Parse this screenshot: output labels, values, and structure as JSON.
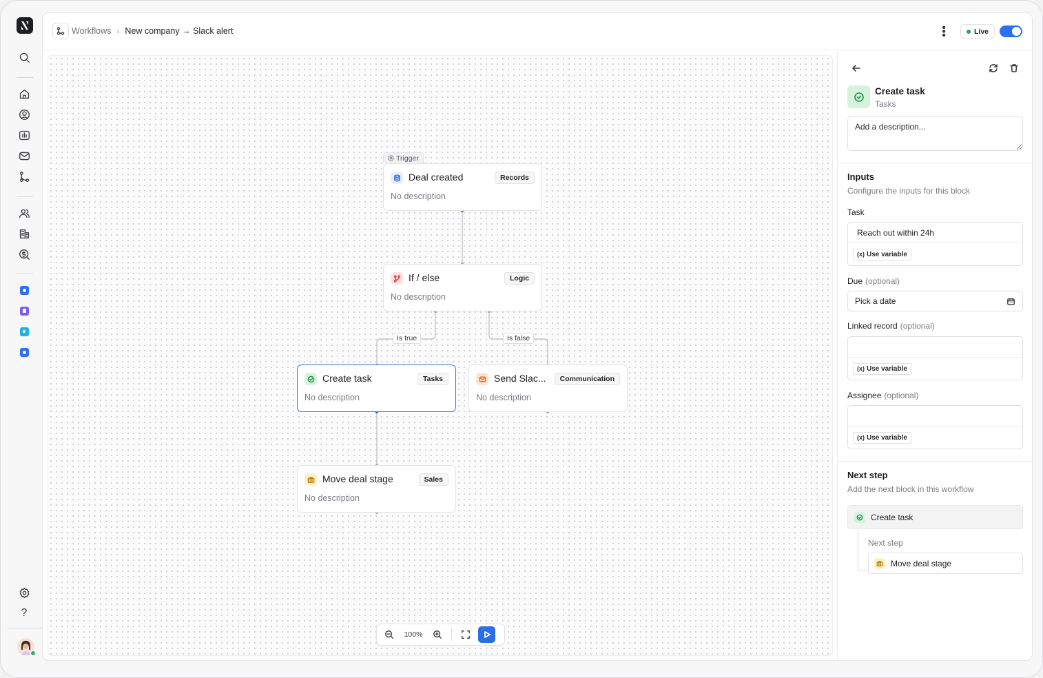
{
  "sidebar": {
    "top_icons": [
      "search-icon"
    ],
    "nav_icons": [
      "home-icon",
      "user-circle-icon",
      "analytics-icon",
      "inbox-icon",
      "workflow-icon"
    ],
    "section_icons": [
      "people-icon",
      "building-icon",
      "dollar-search-icon"
    ],
    "app_icons": [
      {
        "name": "app-blue-icon",
        "color": "#2f6fed"
      },
      {
        "name": "app-purple-icon",
        "color": "#7b5cf0"
      },
      {
        "name": "app-cyan-icon",
        "color": "#1fb1e0"
      },
      {
        "name": "app-blue2-icon",
        "color": "#2f6fed"
      }
    ],
    "bottom_icons": [
      "settings-icon",
      "help-icon"
    ]
  },
  "header": {
    "breadcrumb_root": "Workflows",
    "breadcrumb_current": "New company → Slack alert",
    "status": "Live",
    "live_on": true
  },
  "canvas": {
    "trigger_label": "Trigger",
    "nodes": [
      {
        "id": "deal-created",
        "title": "Deal created",
        "tag": "Records",
        "desc": "No description",
        "icon": "database-icon",
        "icon_bg": "#e7eefc",
        "icon_color": "#3b6fd6"
      },
      {
        "id": "if-else",
        "title": "If / else",
        "tag": "Logic",
        "desc": "No description",
        "icon": "branch-icon",
        "icon_bg": "#fde1e1",
        "icon_color": "#d84545"
      },
      {
        "id": "create-task",
        "title": "Create task",
        "tag": "Tasks",
        "desc": "No description",
        "icon": "check-circle-icon",
        "icon_bg": "#d6f3dd",
        "icon_color": "#1f8f46"
      },
      {
        "id": "send-slack",
        "title": "Send Slac...",
        "tag": "Communication",
        "desc": "No description",
        "icon": "mail-icon",
        "icon_bg": "#fde3d2",
        "icon_color": "#e0702a"
      },
      {
        "id": "move-deal-stage",
        "title": "Move deal stage",
        "tag": "Sales",
        "desc": "No description",
        "icon": "briefcase-icon",
        "icon_bg": "#fdf0c8",
        "icon_color": "#b88412"
      }
    ],
    "edge_true": "Is true",
    "edge_false": "Is false",
    "zoom": "100%"
  },
  "panel": {
    "title": "Create task",
    "subtitle": "Tasks",
    "description_placeholder": "Add a description...",
    "inputs_heading": "Inputs",
    "inputs_sub": "Configure the inputs for this block",
    "task_label": "Task",
    "task_value": "Reach out within 24h",
    "use_variable": "Use variable",
    "due_label": "Due",
    "optional": "(optional)",
    "due_value": "Pick a date",
    "linked_label": "Linked record",
    "assignee_label": "Assignee",
    "next_heading": "Next step",
    "next_sub": "Add the next block in this workflow",
    "next_item": "Create task",
    "next_child_label": "Next step",
    "next_child_item": "Move deal stage"
  }
}
